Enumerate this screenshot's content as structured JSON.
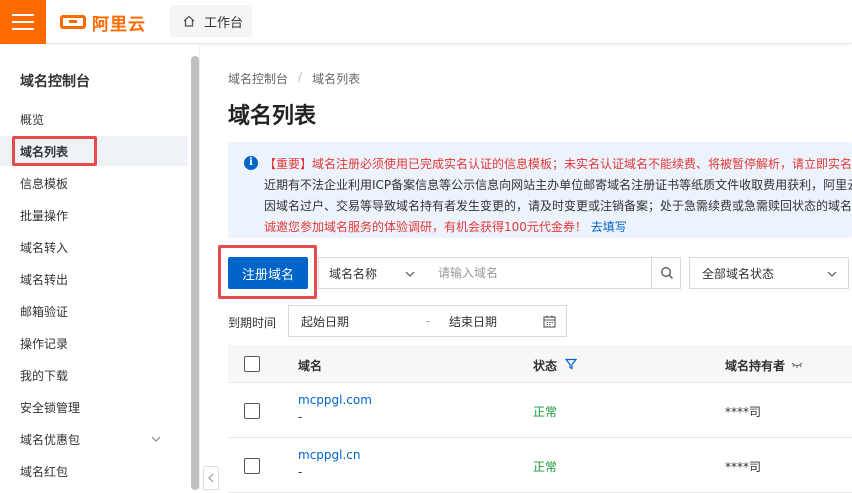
{
  "topbar": {
    "logo_text": "阿里云",
    "workbench_label": "工作台"
  },
  "sidebar": {
    "title": "域名控制台",
    "items": [
      {
        "label": "概览"
      },
      {
        "label": "域名列表"
      },
      {
        "label": "信息模板"
      },
      {
        "label": "批量操作"
      },
      {
        "label": "域名转入"
      },
      {
        "label": "域名转出"
      },
      {
        "label": "邮箱验证"
      },
      {
        "label": "操作记录"
      },
      {
        "label": "我的下载"
      },
      {
        "label": "安全锁管理"
      },
      {
        "label": "域名优惠包"
      },
      {
        "label": "域名红包"
      }
    ]
  },
  "breadcrumb": {
    "root": "域名控制台",
    "sep": "/",
    "current": "域名列表"
  },
  "page_title": "域名列表",
  "notice": {
    "line1_red": "【重要】域名注册必须使用已完成实名认证的信息模板；未实名认证域名不能续费、将被暂停解析，请立即实名",
    "line2": "近期有不法企业利用ICP备案信息等公示信息向网站主办单位邮寄域名注册证书等纸质文件收取费用获利，阿里云",
    "line3": "因域名过户、交易等导致域名持有者发生变更的，请及时变更或注销备案；处于急需续费或急需赎回状态的域名",
    "line4_red": "诚邀您参加域名服务的体验调研，有机会获得100元代金券！",
    "line4_link": "去填写"
  },
  "toolbar": {
    "register_label": "注册域名",
    "search_field_select": "域名名称",
    "search_placeholder": "请输入域名",
    "status_select": "全部域名状态"
  },
  "filter": {
    "expiry_label": "到期时间",
    "start_placeholder": "起始日期",
    "dash": "-",
    "end_placeholder": "结束日期"
  },
  "table": {
    "headers": {
      "domain": "域名",
      "status": "状态",
      "holder": "域名持有者"
    },
    "rows": [
      {
        "domain": "mcppgl.com",
        "sub": "-",
        "status": "正常",
        "holder": "****司"
      },
      {
        "domain": "mcppgl.cn",
        "sub": "-",
        "status": "正常",
        "holder": "****司"
      }
    ]
  },
  "colors": {
    "brand": "#ff6a00",
    "primary": "#0064c8",
    "highlight": "#e74c4c",
    "success": "#1b9a3a",
    "notice_bg": "#ecf3fc"
  }
}
